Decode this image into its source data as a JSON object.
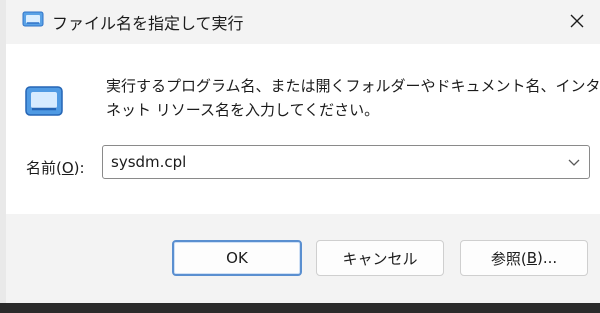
{
  "window": {
    "title": "ファイル名を指定して実行",
    "close_label": "✕"
  },
  "description": {
    "line1": "実行するプログラム名、または開くフォルダーやドキュメント名、インター",
    "line2": "ネット リソース名を入力してください。"
  },
  "name_field": {
    "label_prefix": "名前(",
    "label_accel": "O",
    "label_suffix": "):",
    "value": "sysdm.cpl"
  },
  "buttons": {
    "ok": "OK",
    "cancel": "キャンセル",
    "browse_prefix": "参照(",
    "browse_accel": "B",
    "browse_suffix": ")..."
  },
  "icons": {
    "title": "run-icon",
    "large": "run-icon",
    "dropdown": "chevron-down-icon",
    "close": "close-icon"
  },
  "colors": {
    "accent": "#2f73c8",
    "ok_border": "#5a8fd0"
  }
}
